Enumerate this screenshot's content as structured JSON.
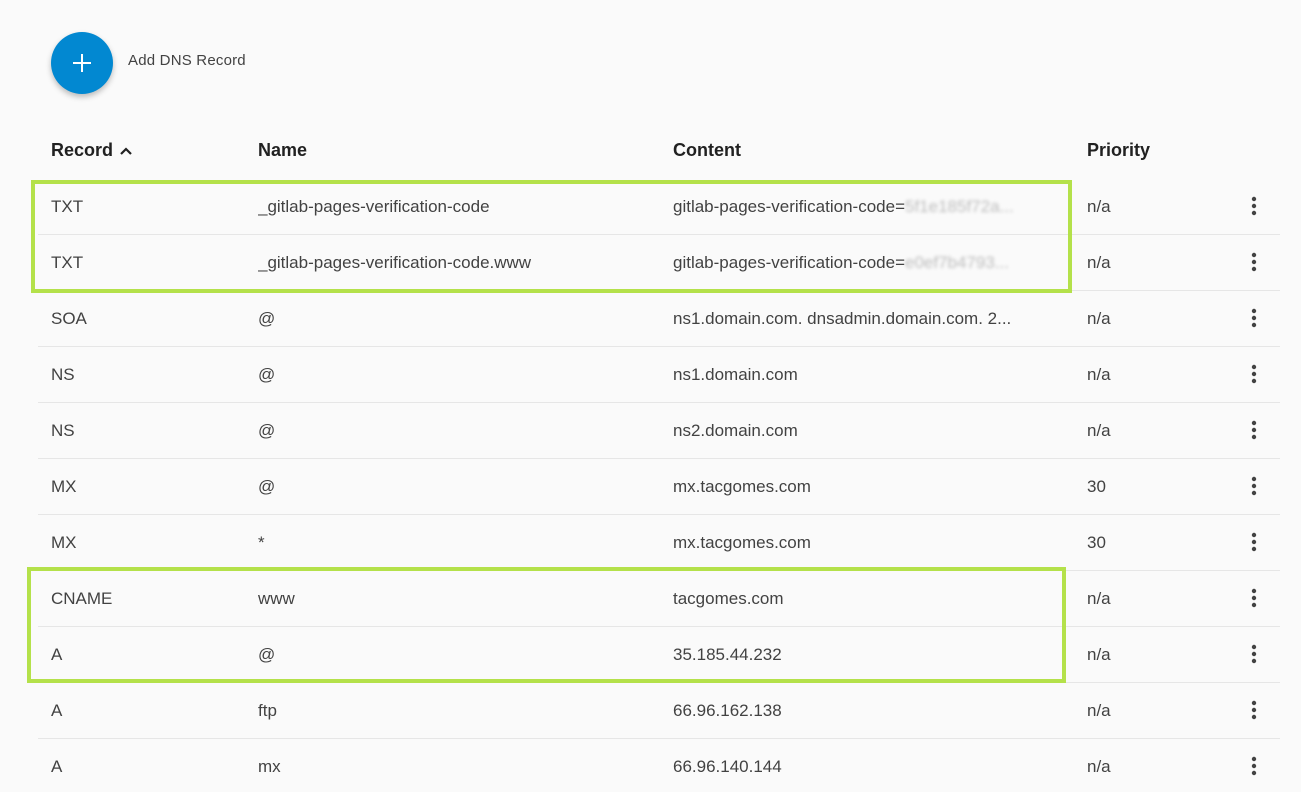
{
  "toolbar": {
    "add_label": "Add DNS Record",
    "add_icon": "plus-icon",
    "accent": "#0288d1"
  },
  "columns": {
    "record": "Record",
    "name": "Name",
    "content": "Content",
    "priority": "Priority",
    "sort_icon": "chevron-up-icon"
  },
  "rows": [
    {
      "record": "TXT",
      "name": "_gitlab-pages-verification-code",
      "content": "gitlab-pages-verification-code=",
      "content_tail": "5f1e185f72a...",
      "priority": "n/a"
    },
    {
      "record": "TXT",
      "name": "_gitlab-pages-verification-code.www",
      "content": "gitlab-pages-verification-code=",
      "content_tail": "e0ef7b4793...",
      "priority": "n/a"
    },
    {
      "record": "SOA",
      "name": "@",
      "content": "ns1.domain.com. dnsadmin.domain.com. 2...",
      "content_tail": "",
      "priority": "n/a"
    },
    {
      "record": "NS",
      "name": "@",
      "content": "ns1.domain.com",
      "content_tail": "",
      "priority": "n/a"
    },
    {
      "record": "NS",
      "name": "@",
      "content": "ns2.domain.com",
      "content_tail": "",
      "priority": "n/a"
    },
    {
      "record": "MX",
      "name": "@",
      "content": "mx.tacgomes.com",
      "content_tail": "",
      "priority": "30"
    },
    {
      "record": "MX",
      "name": "*",
      "content": "mx.tacgomes.com",
      "content_tail": "",
      "priority": "30"
    },
    {
      "record": "CNAME",
      "name": "www",
      "content": "tacgomes.com",
      "content_tail": "",
      "priority": "n/a"
    },
    {
      "record": "A",
      "name": "@",
      "content": "35.185.44.232",
      "content_tail": "",
      "priority": "n/a"
    },
    {
      "record": "A",
      "name": "ftp",
      "content": "66.96.162.138",
      "content_tail": "",
      "priority": "n/a"
    },
    {
      "record": "A",
      "name": "mx",
      "content": "66.96.140.144",
      "content_tail": "",
      "priority": "n/a"
    }
  ],
  "row_menu_icon": "more-vertical-icon",
  "highlight_color": "#b4e14a"
}
